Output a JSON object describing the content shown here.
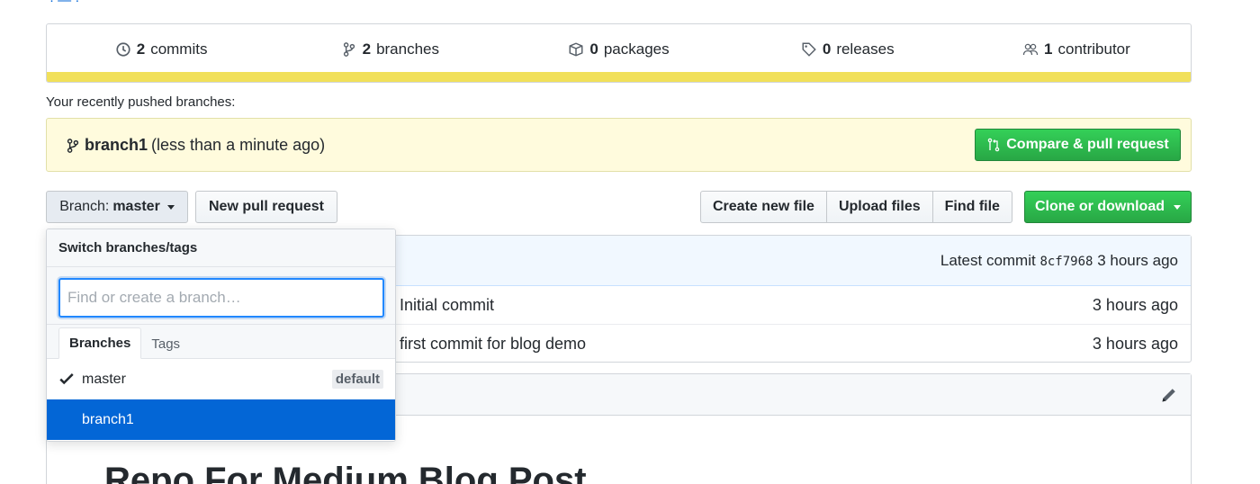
{
  "summary": {
    "commits": {
      "count": "2",
      "label": "commits",
      "icon": "history-icon"
    },
    "branches": {
      "count": "2",
      "label": "branches",
      "icon": "git-branch-icon"
    },
    "packages": {
      "count": "0",
      "label": "packages",
      "icon": "package-icon"
    },
    "releases": {
      "count": "0",
      "label": "releases",
      "icon": "tag-icon"
    },
    "contributors": {
      "count": "1",
      "label": "contributor",
      "icon": "people-icon"
    },
    "language_bar_color": "#f1e05a"
  },
  "recent": {
    "label": "Your recently pushed branches:",
    "branch": "branch1",
    "time": "(less than a minute ago)",
    "compare_label": "Compare & pull request"
  },
  "toolbar": {
    "branch_prefix": "Branch:",
    "branch_name": "master",
    "new_pr": "New pull request",
    "create_file": "Create new file",
    "upload_files": "Upload files",
    "find_file": "Find file",
    "clone": "Clone or download"
  },
  "commits": {
    "latest_label": "Latest commit",
    "latest_sha": "8cf7968",
    "latest_age": "3 hours ago",
    "rows": [
      {
        "message": "Initial commit",
        "age": "3 hours ago"
      },
      {
        "message": "first commit for blog demo",
        "age": "3 hours ago"
      }
    ]
  },
  "readme": {
    "title": "Repo For Medium Blog Post"
  },
  "dropdown": {
    "title": "Switch branches/tags",
    "filter_placeholder": "Find or create a branch…",
    "tabs": [
      "Branches",
      "Tags"
    ],
    "branches": [
      {
        "name": "master",
        "badge": "default",
        "current": true
      },
      {
        "name": "branch1",
        "badge": "",
        "current": false
      }
    ]
  },
  "colors": {
    "green": "#28a745",
    "blue_selected": "#0366d6",
    "highlight_bg": "#fffbdd"
  }
}
